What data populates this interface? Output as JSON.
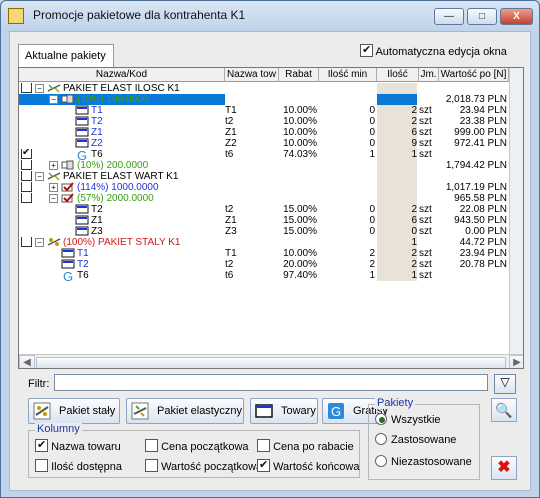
{
  "window": {
    "title": "Promocje pakietowe dla kontrahenta K1",
    "min": "—",
    "max": "□",
    "close": "X"
  },
  "tab": {
    "label": "Aktualne pakiety"
  },
  "auto_edit": {
    "label": "Automatyczna edycja okna",
    "checked": true
  },
  "grid": {
    "headers": [
      "Nazwa/Kod",
      "Nazwa tow",
      "Rabat",
      "Ilość min",
      "Ilość",
      "Jm.",
      "Wartość po [N]"
    ],
    "rows": [
      {
        "indent": 0,
        "icon": "scale",
        "name": "PAKIET ELAST ILOSC K1",
        "name_color": "",
        "towar": "",
        "rabat": "",
        "ilmin": "",
        "ilosc": "",
        "jm": "",
        "wart": "",
        "checked": false,
        "expanded": true,
        "has_cb": true,
        "sel": false
      },
      {
        "indent": 1,
        "icon": "bundle",
        "name": "(10%) 100.0000",
        "name_color": "green",
        "towar": "",
        "rabat": "",
        "ilmin": "",
        "ilosc": "",
        "jm": "",
        "wart": "2,018.73 PLN",
        "checked": false,
        "expanded": true,
        "has_cb": false,
        "sel": true
      },
      {
        "indent": 2,
        "icon": "item",
        "name": "T1",
        "name_color": "blue",
        "towar": "T1",
        "rabat": "10.00%",
        "ilmin": "0",
        "ilosc": "2",
        "jm": "szt",
        "wart": "23.94 PLN",
        "checked": false,
        "has_cb": false,
        "sel": false
      },
      {
        "indent": 2,
        "icon": "item",
        "name": "T2",
        "name_color": "blue",
        "towar": "t2",
        "rabat": "10.00%",
        "ilmin": "0",
        "ilosc": "2",
        "jm": "szt",
        "wart": "23.38 PLN",
        "checked": false,
        "has_cb": false,
        "sel": false
      },
      {
        "indent": 2,
        "icon": "item",
        "name": "Z1",
        "name_color": "blue",
        "towar": "Z1",
        "rabat": "10.00%",
        "ilmin": "0",
        "ilosc": "6",
        "jm": "szt",
        "wart": "999.00 PLN",
        "checked": false,
        "has_cb": false,
        "sel": false
      },
      {
        "indent": 2,
        "icon": "item",
        "name": "Z2",
        "name_color": "blue",
        "towar": "Z2",
        "rabat": "10.00%",
        "ilmin": "0",
        "ilosc": "9",
        "jm": "szt",
        "wart": "972.41 PLN",
        "checked": false,
        "has_cb": false,
        "sel": false
      },
      {
        "indent": 2,
        "icon": "gratis",
        "name": "T6",
        "name_color": "",
        "towar": "t6",
        "rabat": "74.03%",
        "ilmin": "1",
        "ilosc": "1",
        "jm": "szt",
        "wart": "",
        "checked": true,
        "has_cb": true,
        "sel": false
      },
      {
        "indent": 1,
        "icon": "bundle",
        "name": "(10%) 200.0000",
        "name_color": "green",
        "towar": "",
        "rabat": "",
        "ilmin": "",
        "ilosc": "",
        "jm": "",
        "wart": "1,794.42 PLN",
        "checked": false,
        "expanded": false,
        "has_cb": true,
        "sel": false
      },
      {
        "indent": 0,
        "icon": "scale",
        "name": "PAKIET ELAST WART K1",
        "name_color": "",
        "towar": "",
        "rabat": "",
        "ilmin": "",
        "ilosc": "",
        "jm": "",
        "wart": "",
        "checked": false,
        "expanded": true,
        "has_cb": true,
        "sel": false
      },
      {
        "indent": 1,
        "icon": "bundle-check",
        "name": "(114%) 1000.0000",
        "name_color": "blue",
        "towar": "",
        "rabat": "",
        "ilmin": "",
        "ilosc": "",
        "jm": "",
        "wart": "1,017.19 PLN",
        "checked": false,
        "expanded": false,
        "has_cb": true,
        "sel": false
      },
      {
        "indent": 1,
        "icon": "bundle-check",
        "name": "(57%) 2000.0000",
        "name_color": "green",
        "towar": "",
        "rabat": "",
        "ilmin": "",
        "ilosc": "",
        "jm": "",
        "wart": "965.58 PLN",
        "checked": false,
        "expanded": true,
        "has_cb": true,
        "sel": false
      },
      {
        "indent": 2,
        "icon": "item",
        "name": "T2",
        "name_color": "",
        "towar": "t2",
        "rabat": "15.00%",
        "ilmin": "0",
        "ilosc": "2",
        "jm": "szt",
        "wart": "22.08 PLN",
        "checked": false,
        "has_cb": false,
        "sel": false
      },
      {
        "indent": 2,
        "icon": "item",
        "name": "Z1",
        "name_color": "",
        "towar": "Z1",
        "rabat": "15.00%",
        "ilmin": "0",
        "ilosc": "6",
        "jm": "szt",
        "wart": "943.50 PLN",
        "checked": false,
        "has_cb": false,
        "sel": false
      },
      {
        "indent": 2,
        "icon": "item",
        "name": "Z3",
        "name_color": "",
        "towar": "Z3",
        "rabat": "15.00%",
        "ilmin": "0",
        "ilosc": "0",
        "jm": "szt",
        "wart": "0.00 PLN",
        "checked": false,
        "has_cb": false,
        "sel": false
      },
      {
        "indent": 0,
        "icon": "scale-red",
        "name": "(100%) PAKIET STALY K1",
        "name_color": "red",
        "towar": "",
        "rabat": "",
        "ilmin": "",
        "ilosc": "1",
        "jm": "",
        "wart": "44.72 PLN",
        "checked": false,
        "expanded": true,
        "has_cb": true,
        "sel": false
      },
      {
        "indent": 1,
        "icon": "item",
        "name": "T1",
        "name_color": "blue",
        "towar": "T1",
        "rabat": "10.00%",
        "ilmin": "2",
        "ilosc": "2",
        "jm": "szt",
        "wart": "23.94 PLN",
        "checked": false,
        "has_cb": false,
        "sel": false
      },
      {
        "indent": 1,
        "icon": "item",
        "name": "T2",
        "name_color": "blue",
        "towar": "t2",
        "rabat": "20.00%",
        "ilmin": "2",
        "ilosc": "2",
        "jm": "szt",
        "wart": "20.78 PLN",
        "checked": false,
        "has_cb": false,
        "sel": false
      },
      {
        "indent": 1,
        "icon": "gratis",
        "name": "T6",
        "name_color": "",
        "towar": "t6",
        "rabat": "97.40%",
        "ilmin": "1",
        "ilosc": "1",
        "jm": "szt",
        "wart": "",
        "checked": false,
        "has_cb": false,
        "sel": false
      }
    ]
  },
  "filter": {
    "label": "Filtr:",
    "value": "",
    "btn_icon": "filter-icon"
  },
  "buttons": [
    {
      "label": "Pakiet stały",
      "icon": "fixed-package-icon"
    },
    {
      "label": "Pakiet elastyczny",
      "icon": "flex-package-icon"
    },
    {
      "label": "Towary",
      "icon": "goods-icon"
    },
    {
      "label": "Gratisy",
      "icon": "gratis-icon"
    }
  ],
  "kolumny": {
    "title": "Kolumny",
    "options": [
      {
        "label": "Nazwa towaru",
        "checked": true
      },
      {
        "label": "Cena początkowa",
        "checked": false
      },
      {
        "label": "Cena po rabacie",
        "checked": false
      },
      {
        "label": "Ilość dostępna",
        "checked": false
      },
      {
        "label": "Wartość początkowa",
        "checked": false
      },
      {
        "label": "Wartość końcowa",
        "checked": true
      }
    ]
  },
  "pakiety": {
    "title": "Pakiety",
    "options": [
      {
        "label": "Wszystkie",
        "checked": true
      },
      {
        "label": "Zastosowane",
        "checked": false
      },
      {
        "label": "Niezastosowane",
        "checked": false
      }
    ]
  },
  "colors": {
    "selection": "#0a78d7",
    "green": "#3aa012",
    "blue": "#1d34d8",
    "red": "#d31616"
  }
}
